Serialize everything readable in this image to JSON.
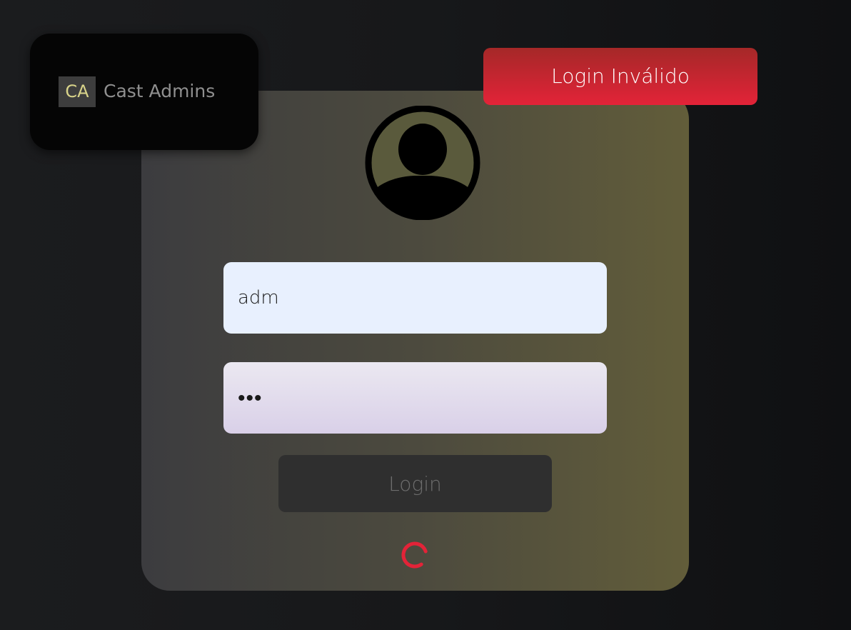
{
  "brand": {
    "mark": "CA",
    "name": "Cast Admins"
  },
  "toast": {
    "message": "Login Inválido",
    "color": "#e32338"
  },
  "form": {
    "username_value": "adm",
    "password_value": "•••",
    "login_label": "Login"
  },
  "colors": {
    "accent": "#e32338",
    "brand_mark_text": "#d9d48a"
  },
  "icons": {
    "avatar": "user-avatar-icon",
    "loading": "loading-spinner-icon"
  }
}
